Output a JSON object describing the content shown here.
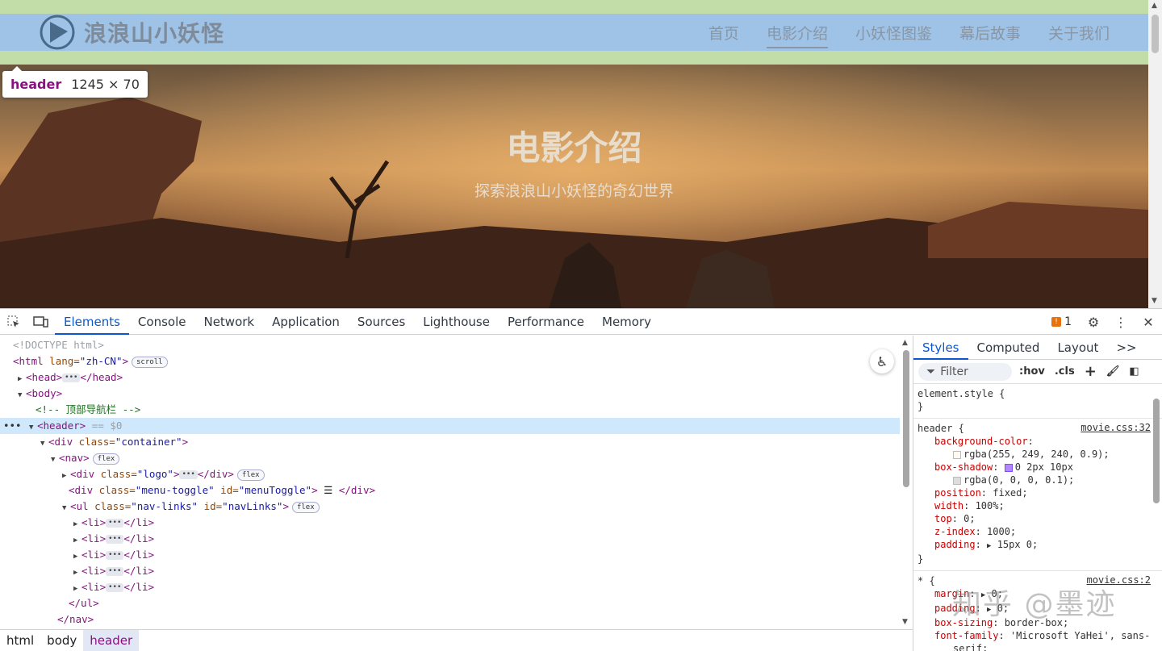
{
  "site": {
    "logo_text": "浪浪山小妖怪",
    "nav": [
      "首页",
      "电影介绍",
      "小妖怪图鉴",
      "幕后故事",
      "关于我们"
    ],
    "hero_title": "电影介绍",
    "hero_subtitle": "探索浪浪山小妖怪的奇幻世界"
  },
  "tooltip": {
    "tag": "header",
    "size": "1245 × 70"
  },
  "devtools": {
    "tabs": [
      "Elements",
      "Console",
      "Network",
      "Application",
      "Sources",
      "Lighthouse",
      "Performance",
      "Memory"
    ],
    "issues_count": "1",
    "dom": {
      "doctype": "<!DOCTYPE html>",
      "html_open": "<html",
      "html_lang_attr": " lang=",
      "html_lang_val": "\"zh-CN\"",
      "html_close_bracket": ">",
      "scroll_badge": "scroll",
      "head": "<head>",
      "head_close": "</head>",
      "body": "<body>",
      "comment": "<!-- 顶部导航栏 -->",
      "header": "<header>",
      "header_ref": " == $0",
      "div_container_open": "<div",
      "class_attr": " class=",
      "container_val": "\"container\"",
      "nav": "<nav>",
      "flex_badge": "flex",
      "logo_val": "\"logo\"",
      "div_close": "</div>",
      "menu_toggle_val": "\"menu-toggle\"",
      "id_attr": " id=",
      "menu_toggle_id": "\"menuToggle\"",
      "menu_glyph": " ☰ ",
      "ul_open": "<ul",
      "nav_links_val": "\"nav-links\"",
      "nav_links_id": "\"navLinks\"",
      "li": "<li>",
      "li_close": "</li>",
      "ul_close": "</ul>",
      "nav_close": "</nav>"
    },
    "breadcrumb": [
      "html",
      "body",
      "header"
    ],
    "styles": {
      "tabs": [
        "Styles",
        "Computed",
        "Layout"
      ],
      "more": ">>",
      "filter_placeholder": "Filter",
      "hov": ":hov",
      "cls": ".cls",
      "element_style": "element.style {",
      "close_brace": "}",
      "header_selector": "header {",
      "header_src": "movie.css:32",
      "universal_selector": "* {",
      "universal_src": "movie.css:2",
      "props": [
        {
          "name": "background-color",
          "value": ""
        },
        {
          "name": "",
          "value": "rgba(255, 249, 240, 0.9);"
        },
        {
          "name": "box-shadow",
          "value": "0 2px 10px"
        },
        {
          "name": "",
          "value": "rgba(0, 0, 0, 0.1);"
        },
        {
          "name": "position",
          "value": "fixed;"
        },
        {
          "name": "width",
          "value": "100%;"
        },
        {
          "name": "top",
          "value": "0;"
        },
        {
          "name": "z-index",
          "value": "1000;"
        },
        {
          "name": "padding",
          "value": "15px 0;"
        }
      ],
      "props2": [
        {
          "name": "margin",
          "value": "0;"
        },
        {
          "name": "padding",
          "value": "0;"
        },
        {
          "name": "box-sizing",
          "value": "border-box;"
        },
        {
          "name": "font-family",
          "value": "'Microsoft YaHei', sans-"
        },
        {
          "name": "",
          "value": "serif;"
        }
      ]
    }
  },
  "watermark": "知乎 @墨迹",
  "colors": {
    "accent": "#0b57d0",
    "tag": "#881280",
    "header_bar": "#c3dda9",
    "header_content": "#9fc2e7"
  }
}
